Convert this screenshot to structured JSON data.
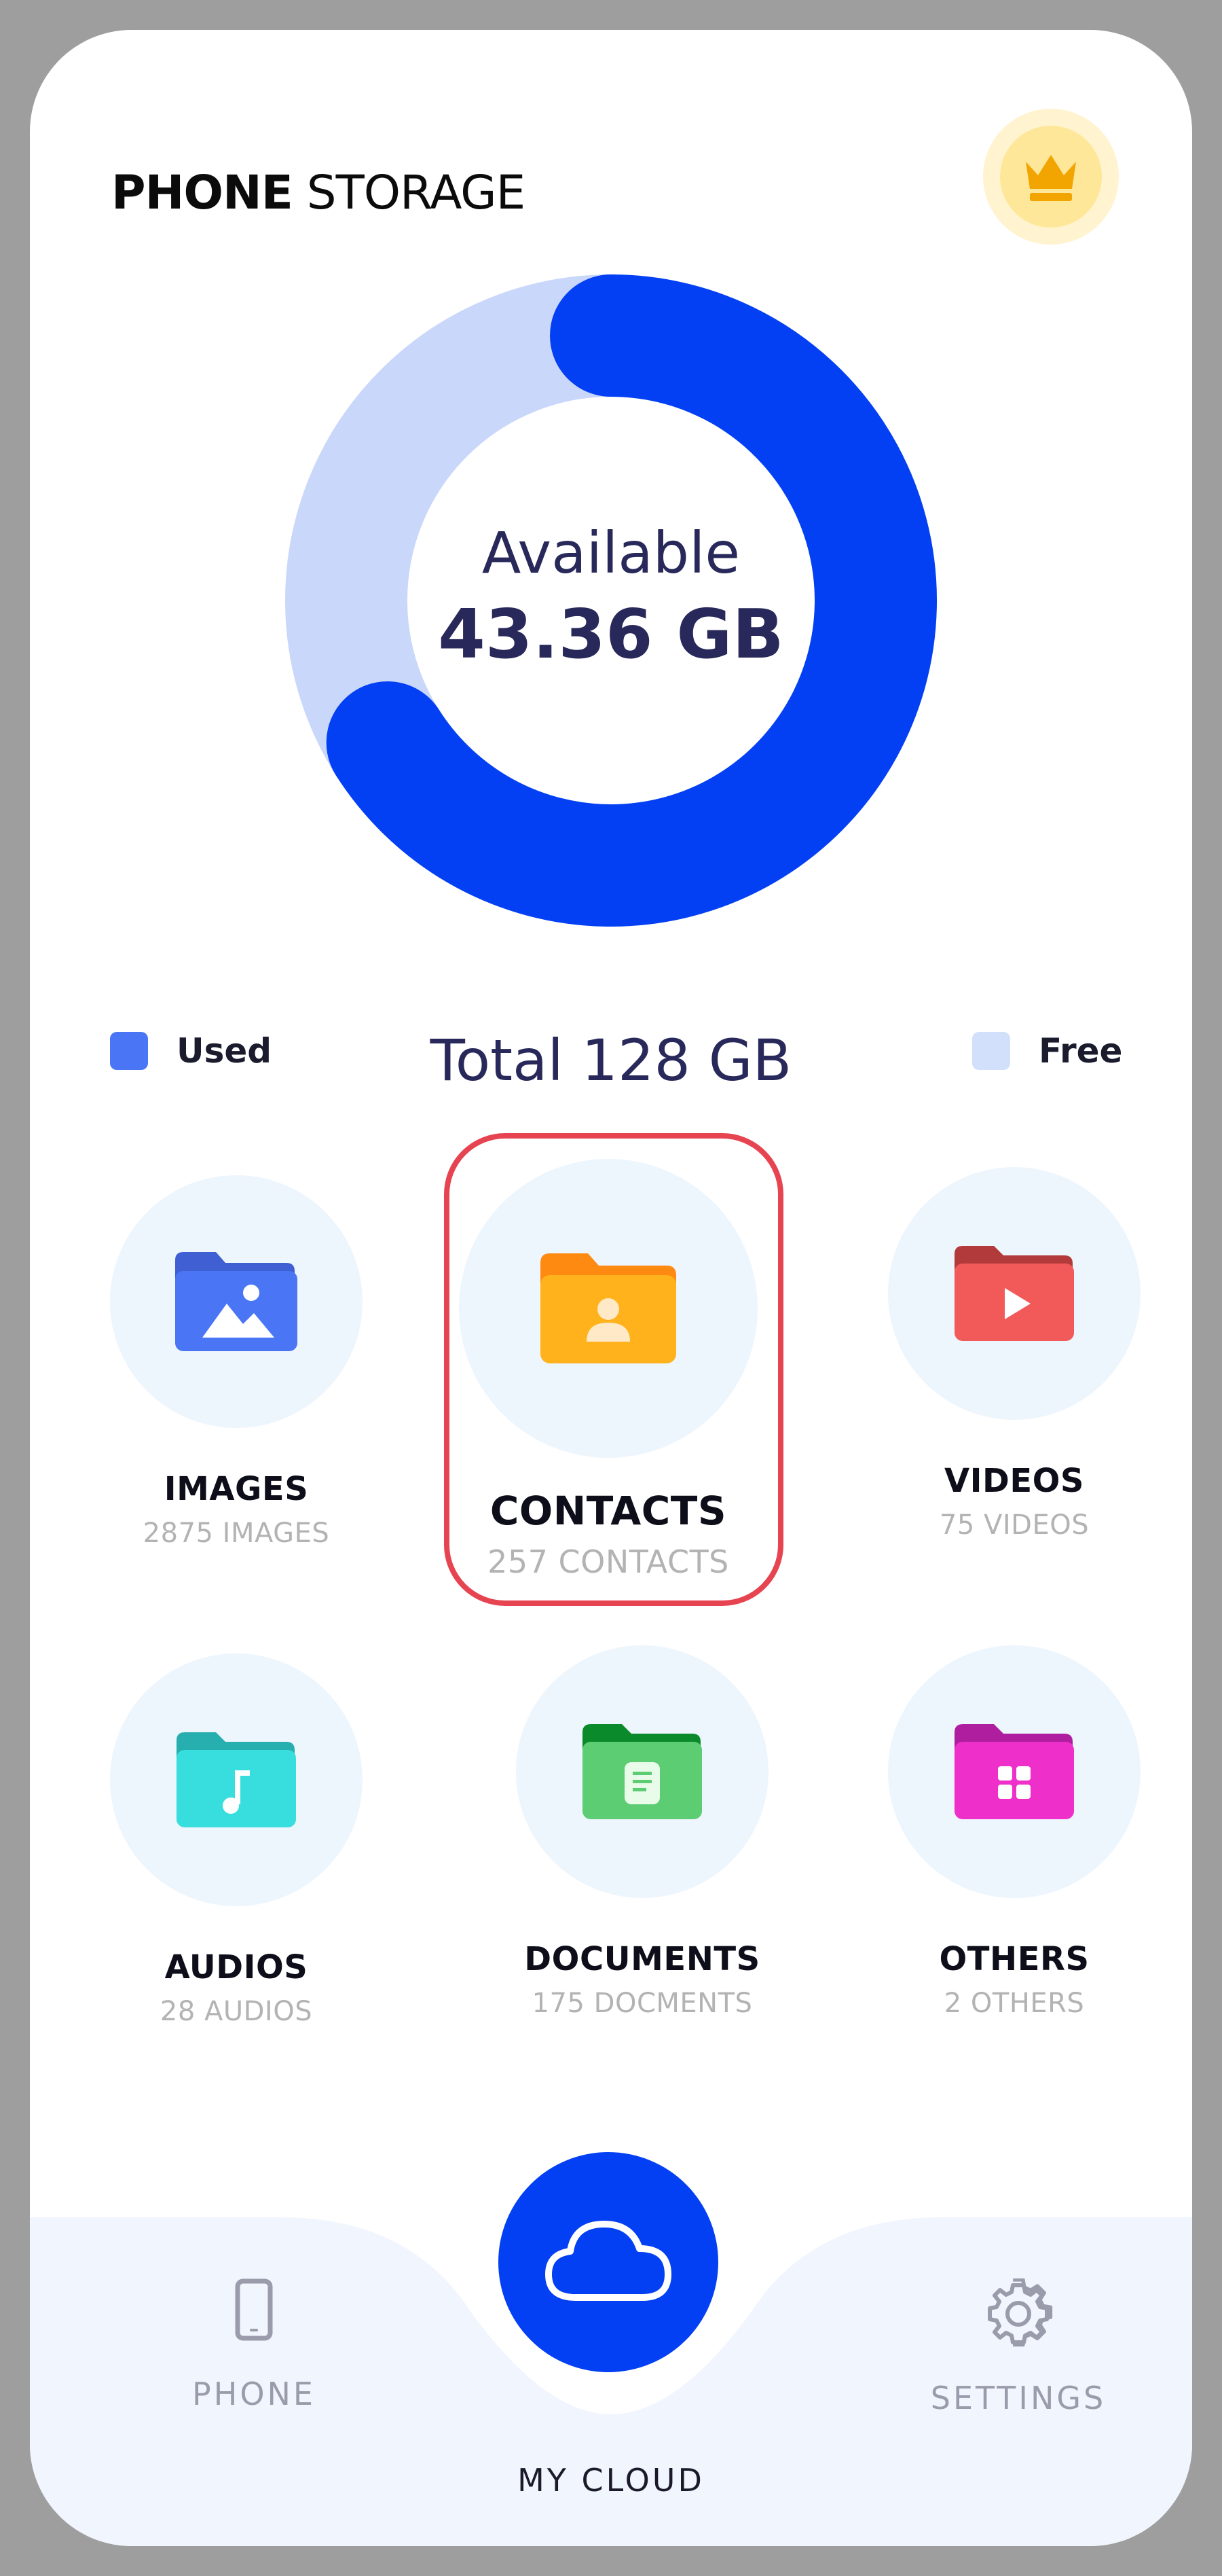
{
  "header": {
    "title_bold": "PHONE",
    "title_light": " STORAGE",
    "premium_icon": "crown-icon"
  },
  "storage": {
    "available_label": "Available",
    "available_value": "43.36 GB",
    "total_label": "Total 128 GB",
    "used_fraction": 0.66,
    "colors": {
      "used": "#0440f3",
      "free": "#c9d7fa"
    },
    "legend": {
      "used_label": "Used",
      "free_label": "Free",
      "used_swatch": "#4a76f6",
      "free_swatch": "#d3e0fb"
    }
  },
  "categories": [
    {
      "title": "IMAGES",
      "count": "2875 IMAGES",
      "icon": "image-folder-icon",
      "color": "#4a76f6",
      "tab": "#3f5fd3"
    },
    {
      "title": "CONTACTS",
      "count": "257 CONTACTS",
      "icon": "contact-folder-icon",
      "color": "#ffb21c",
      "tab": "#ff8a12",
      "selected": true
    },
    {
      "title": "VIDEOS",
      "count": "75 VIDEOS",
      "icon": "video-folder-icon",
      "color": "#f25a5a",
      "tab": "#b23a3a"
    },
    {
      "title": "AUDIOS",
      "count": "28 AUDIOS",
      "icon": "audio-folder-icon",
      "color": "#38dede",
      "tab": "#27aeae"
    },
    {
      "title": "DOCUMENTS",
      "count": "175 DOCMENTS",
      "icon": "document-folder-icon",
      "color": "#5dcd73",
      "tab": "#0b8a2c"
    },
    {
      "title": "OTHERS",
      "count": "2 OTHERS",
      "icon": "grid-folder-icon",
      "color": "#ef2fc9",
      "tab": "#b01ea0"
    }
  ],
  "bottom_nav": {
    "phone_label": "PHONE",
    "cloud_label": "MY CLOUD",
    "settings_label": "SETTINGS",
    "background": "#f1f5fd"
  }
}
